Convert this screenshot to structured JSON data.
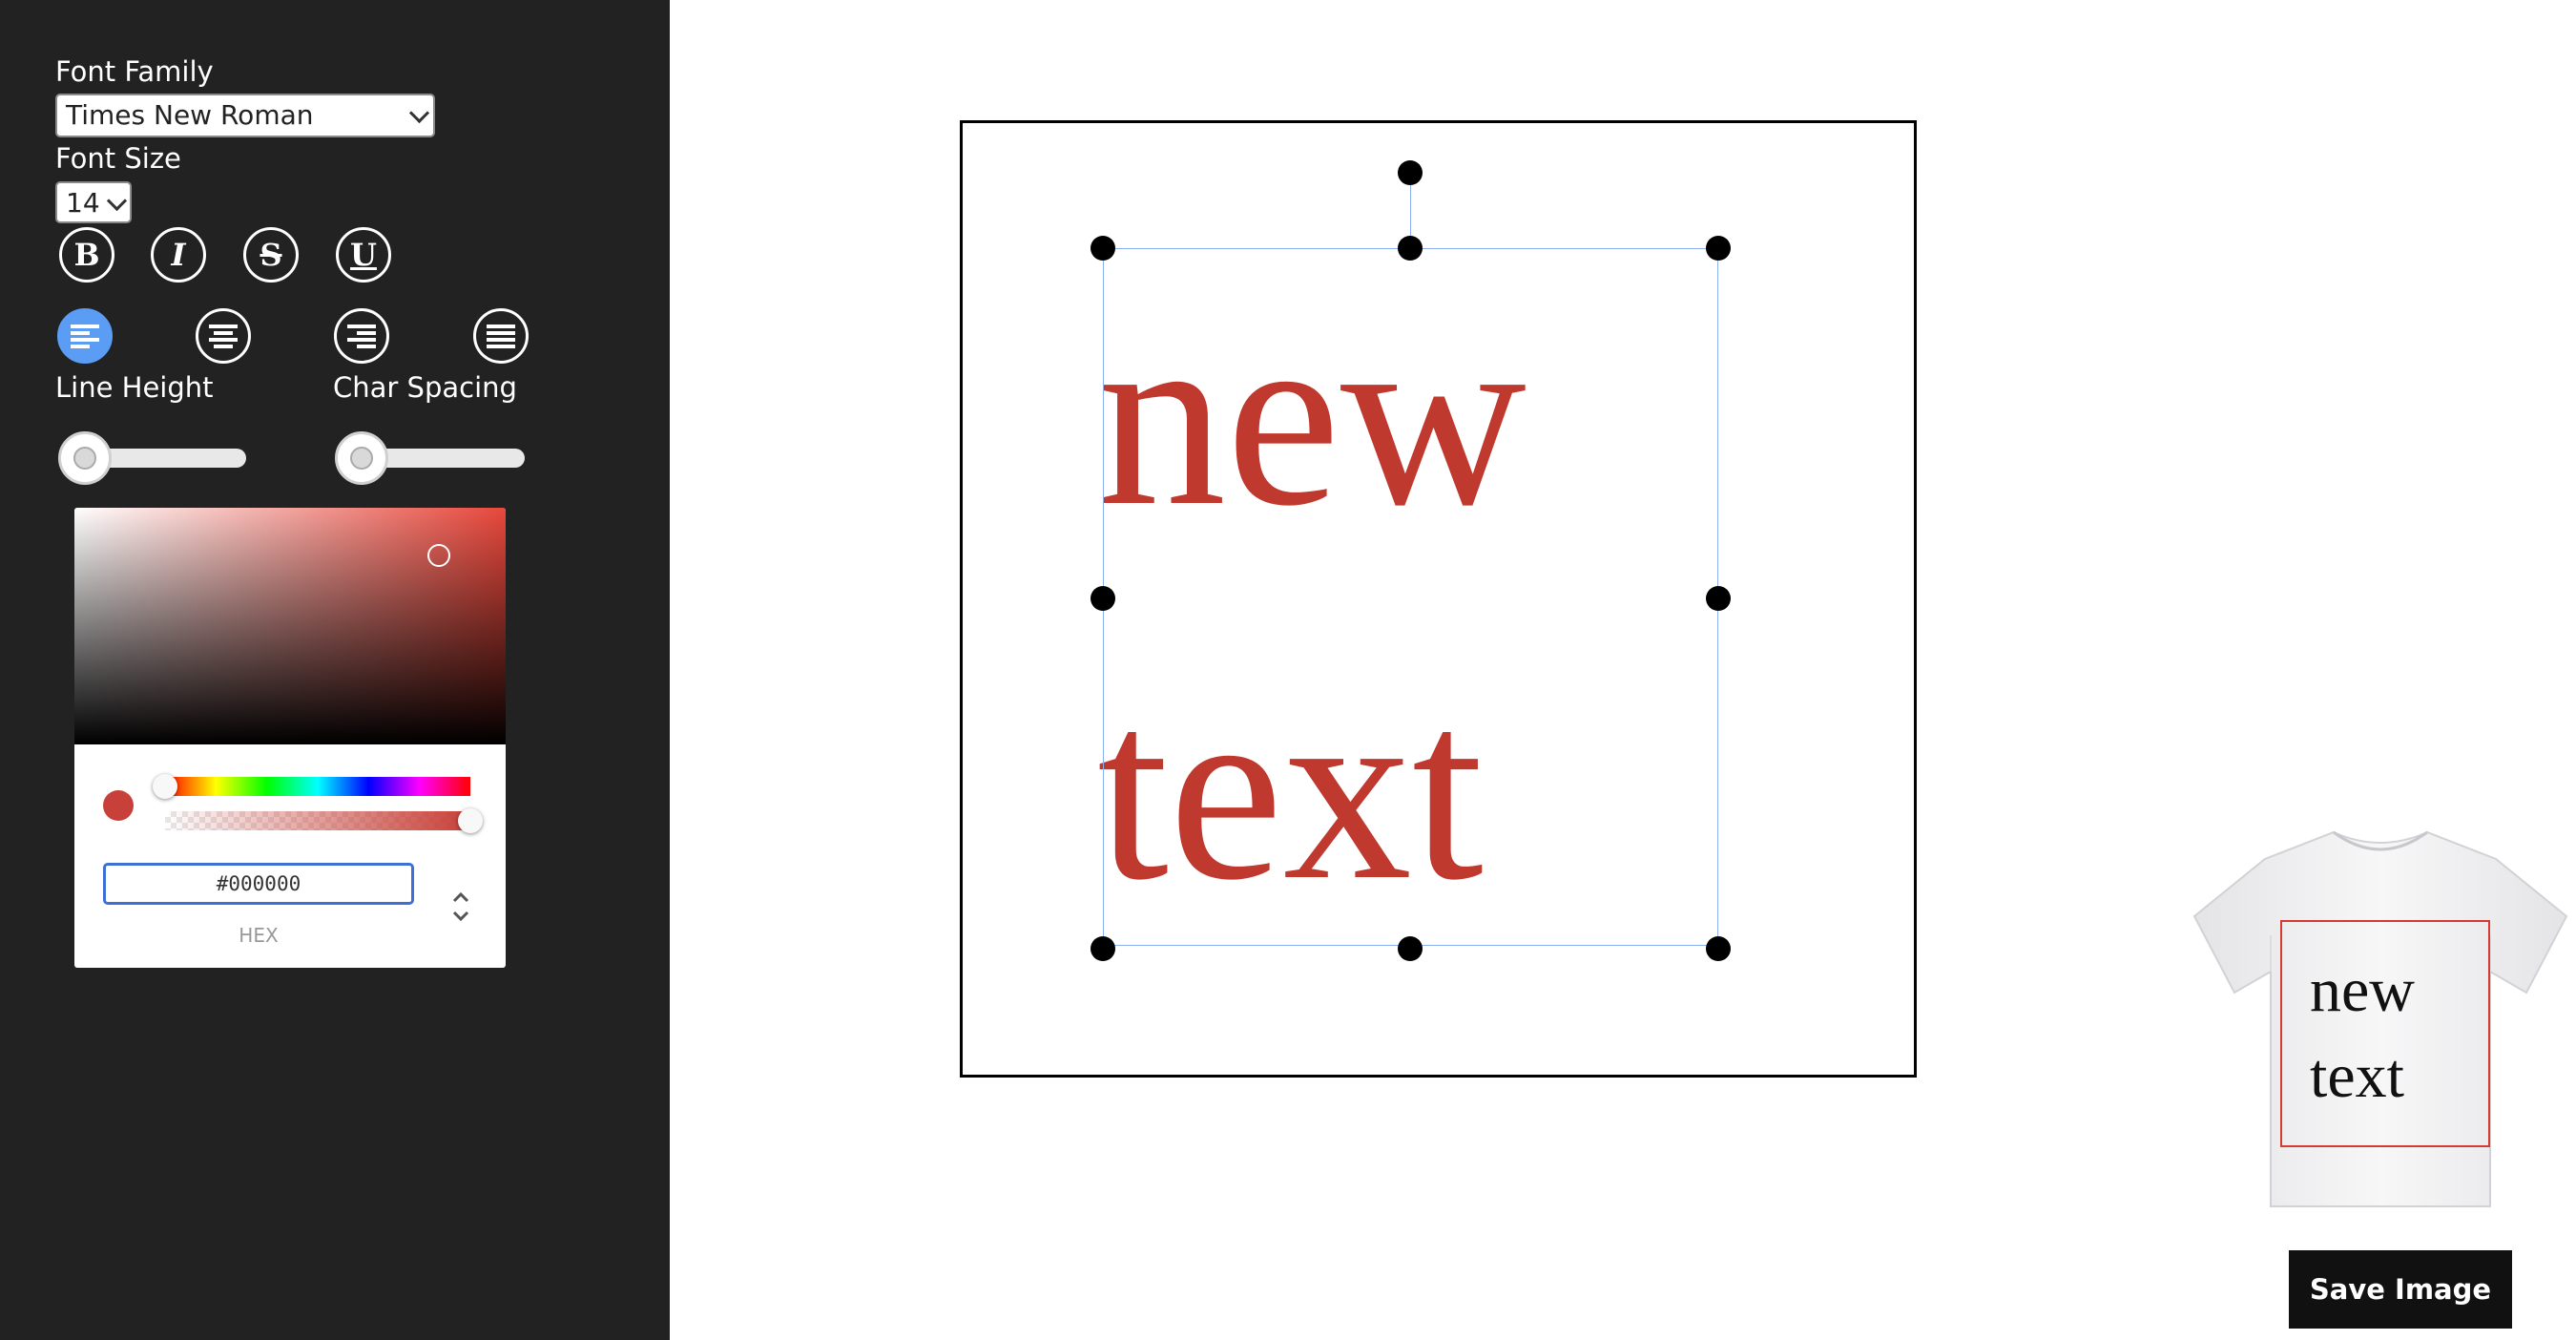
{
  "sidebar": {
    "font_family_label": "Font Family",
    "font_family_value": "Times New Roman",
    "font_size_label": "Font Size",
    "font_size_value": "14",
    "style_buttons": {
      "bold": "B",
      "italic": "I",
      "strikethrough": "S",
      "underline": "U"
    },
    "align_buttons": [
      "align-left",
      "align-center",
      "align-right",
      "align-justify"
    ],
    "active_alignment": "align-left",
    "line_height_label": "Line Height",
    "char_spacing_label": "Char Spacing",
    "line_height_value": 0,
    "char_spacing_value": 0
  },
  "color_picker": {
    "selected_color": "#c8403a",
    "hex_value": "#000000",
    "format_label": "HEX",
    "hue_position": 0,
    "alpha": 1
  },
  "canvas": {
    "text_line1": "new",
    "text_line2": "text",
    "text_color": "#c0392f"
  },
  "preview": {
    "text_line1": "new",
    "text_line2": "text"
  },
  "save_button_label": "Save Image"
}
